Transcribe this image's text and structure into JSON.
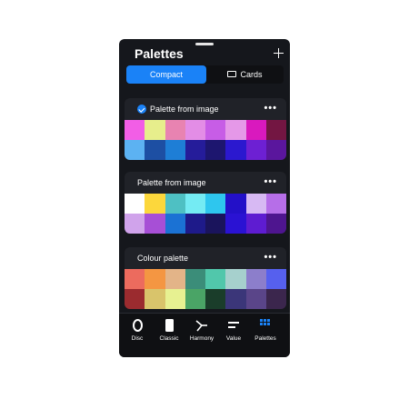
{
  "header": {
    "title": "Palettes",
    "add_icon": "plus-icon"
  },
  "segmented": {
    "compact_label": "Compact",
    "cards_label": "Cards",
    "selected": "Compact"
  },
  "accent_color": "#1a82f7",
  "palettes": [
    {
      "name": "Palette from image",
      "selected": true,
      "colors": [
        "#f25ee6",
        "#e7ee8c",
        "#e883b1",
        "#e38de6",
        "#c75de6",
        "#e598e8",
        "#d919be",
        "#731642",
        "#5cb2f2",
        "#1d4fa3",
        "#1e7ed6",
        "#251c9a",
        "#1d166f",
        "#2b18cf",
        "#6d20d3",
        "#5a169d"
      ]
    },
    {
      "name": "Palette from image",
      "selected": false,
      "colors": [
        "#ffffff",
        "#fcd73c",
        "#4ec0c3",
        "#74ebf3",
        "#2ec6ee",
        "#2310c8",
        "#d7b9f3",
        "#b66ee8",
        "#d0a3eb",
        "#a74fd6",
        "#1b72d4",
        "#1e1a8a",
        "#1a145c",
        "#2a12d3",
        "#5e1cd1",
        "#4e158f"
      ]
    },
    {
      "name": "Colour palette",
      "selected": false,
      "colors": [
        "#ec6b5e",
        "#f49642",
        "#e3b488",
        "#3b8d79",
        "#51c7ab",
        "#a6d0cd",
        "#8c7ecb",
        "#5660ee",
        "#9b2b2f",
        "#d9c46b",
        "#e7f191",
        "#4aa466",
        "#1a3d2a",
        "#3b3679",
        "#5a4589",
        "#3b264d"
      ]
    }
  ],
  "tabbar": {
    "items": [
      {
        "label": "Disc",
        "icon": "disc-icon"
      },
      {
        "label": "Classic",
        "icon": "square-icon"
      },
      {
        "label": "Harmony",
        "icon": "harmony-icon"
      },
      {
        "label": "Value",
        "icon": "value-bars-icon"
      },
      {
        "label": "Palettes",
        "icon": "palettes-grid-icon"
      }
    ],
    "active": "Palettes"
  }
}
